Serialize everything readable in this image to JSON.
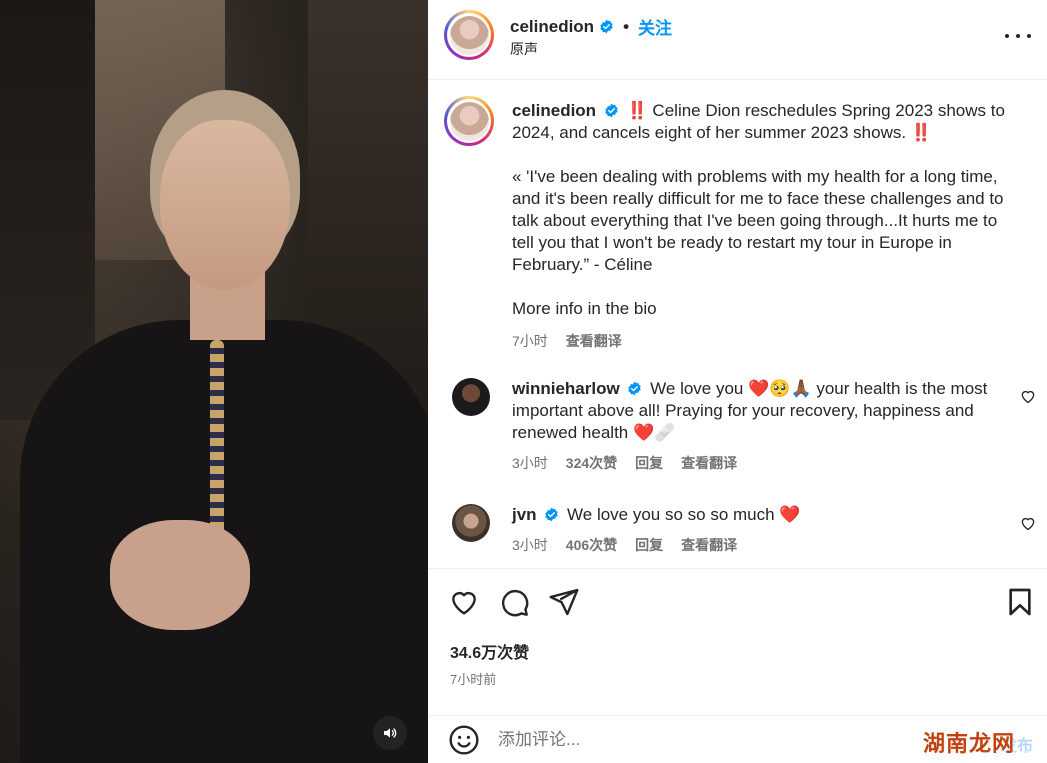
{
  "header": {
    "username": "celinedion",
    "separator": "•",
    "follow_label": "关注",
    "subtitle": "原声"
  },
  "caption": {
    "username": "celinedion",
    "paragraph1": "‼️ Celine Dion reschedules Spring 2023 shows to 2024, and cancels eight of her summer 2023 shows. ‼️",
    "paragraph2": "« 'I've been dealing with problems with my health for a long time, and it's been really difficult for me to face these challenges and to talk about everything that I've been going through...It hurts me to tell you that I won't be ready to restart my tour in Europe in February.” - Céline",
    "paragraph3": "More info in the bio",
    "time": "7小时",
    "translate": "查看翻译"
  },
  "comments": [
    {
      "username": "winnieharlow",
      "text": "We love you ❤️🥺🙏🏾 your health is the most important above all! Praying for your recovery, happiness and renewed health ❤️🩹",
      "time": "3小时",
      "likes": "324次赞",
      "reply": "回复",
      "translate": "查看翻译"
    },
    {
      "username": "jvn",
      "text": "We love you so so so much ❤️",
      "time": "3小时",
      "likes": "406次赞",
      "reply": "回复",
      "translate": "查看翻译"
    }
  ],
  "stats": {
    "likes": "34.6万次赞",
    "time_ago": "7小时前"
  },
  "comment_bar": {
    "placeholder": "添加评论...",
    "post_label": "发布",
    "watermark": "湖南龙网"
  },
  "colors": {
    "accent": "#0095f6",
    "text": "#262626",
    "muted": "#737373"
  }
}
